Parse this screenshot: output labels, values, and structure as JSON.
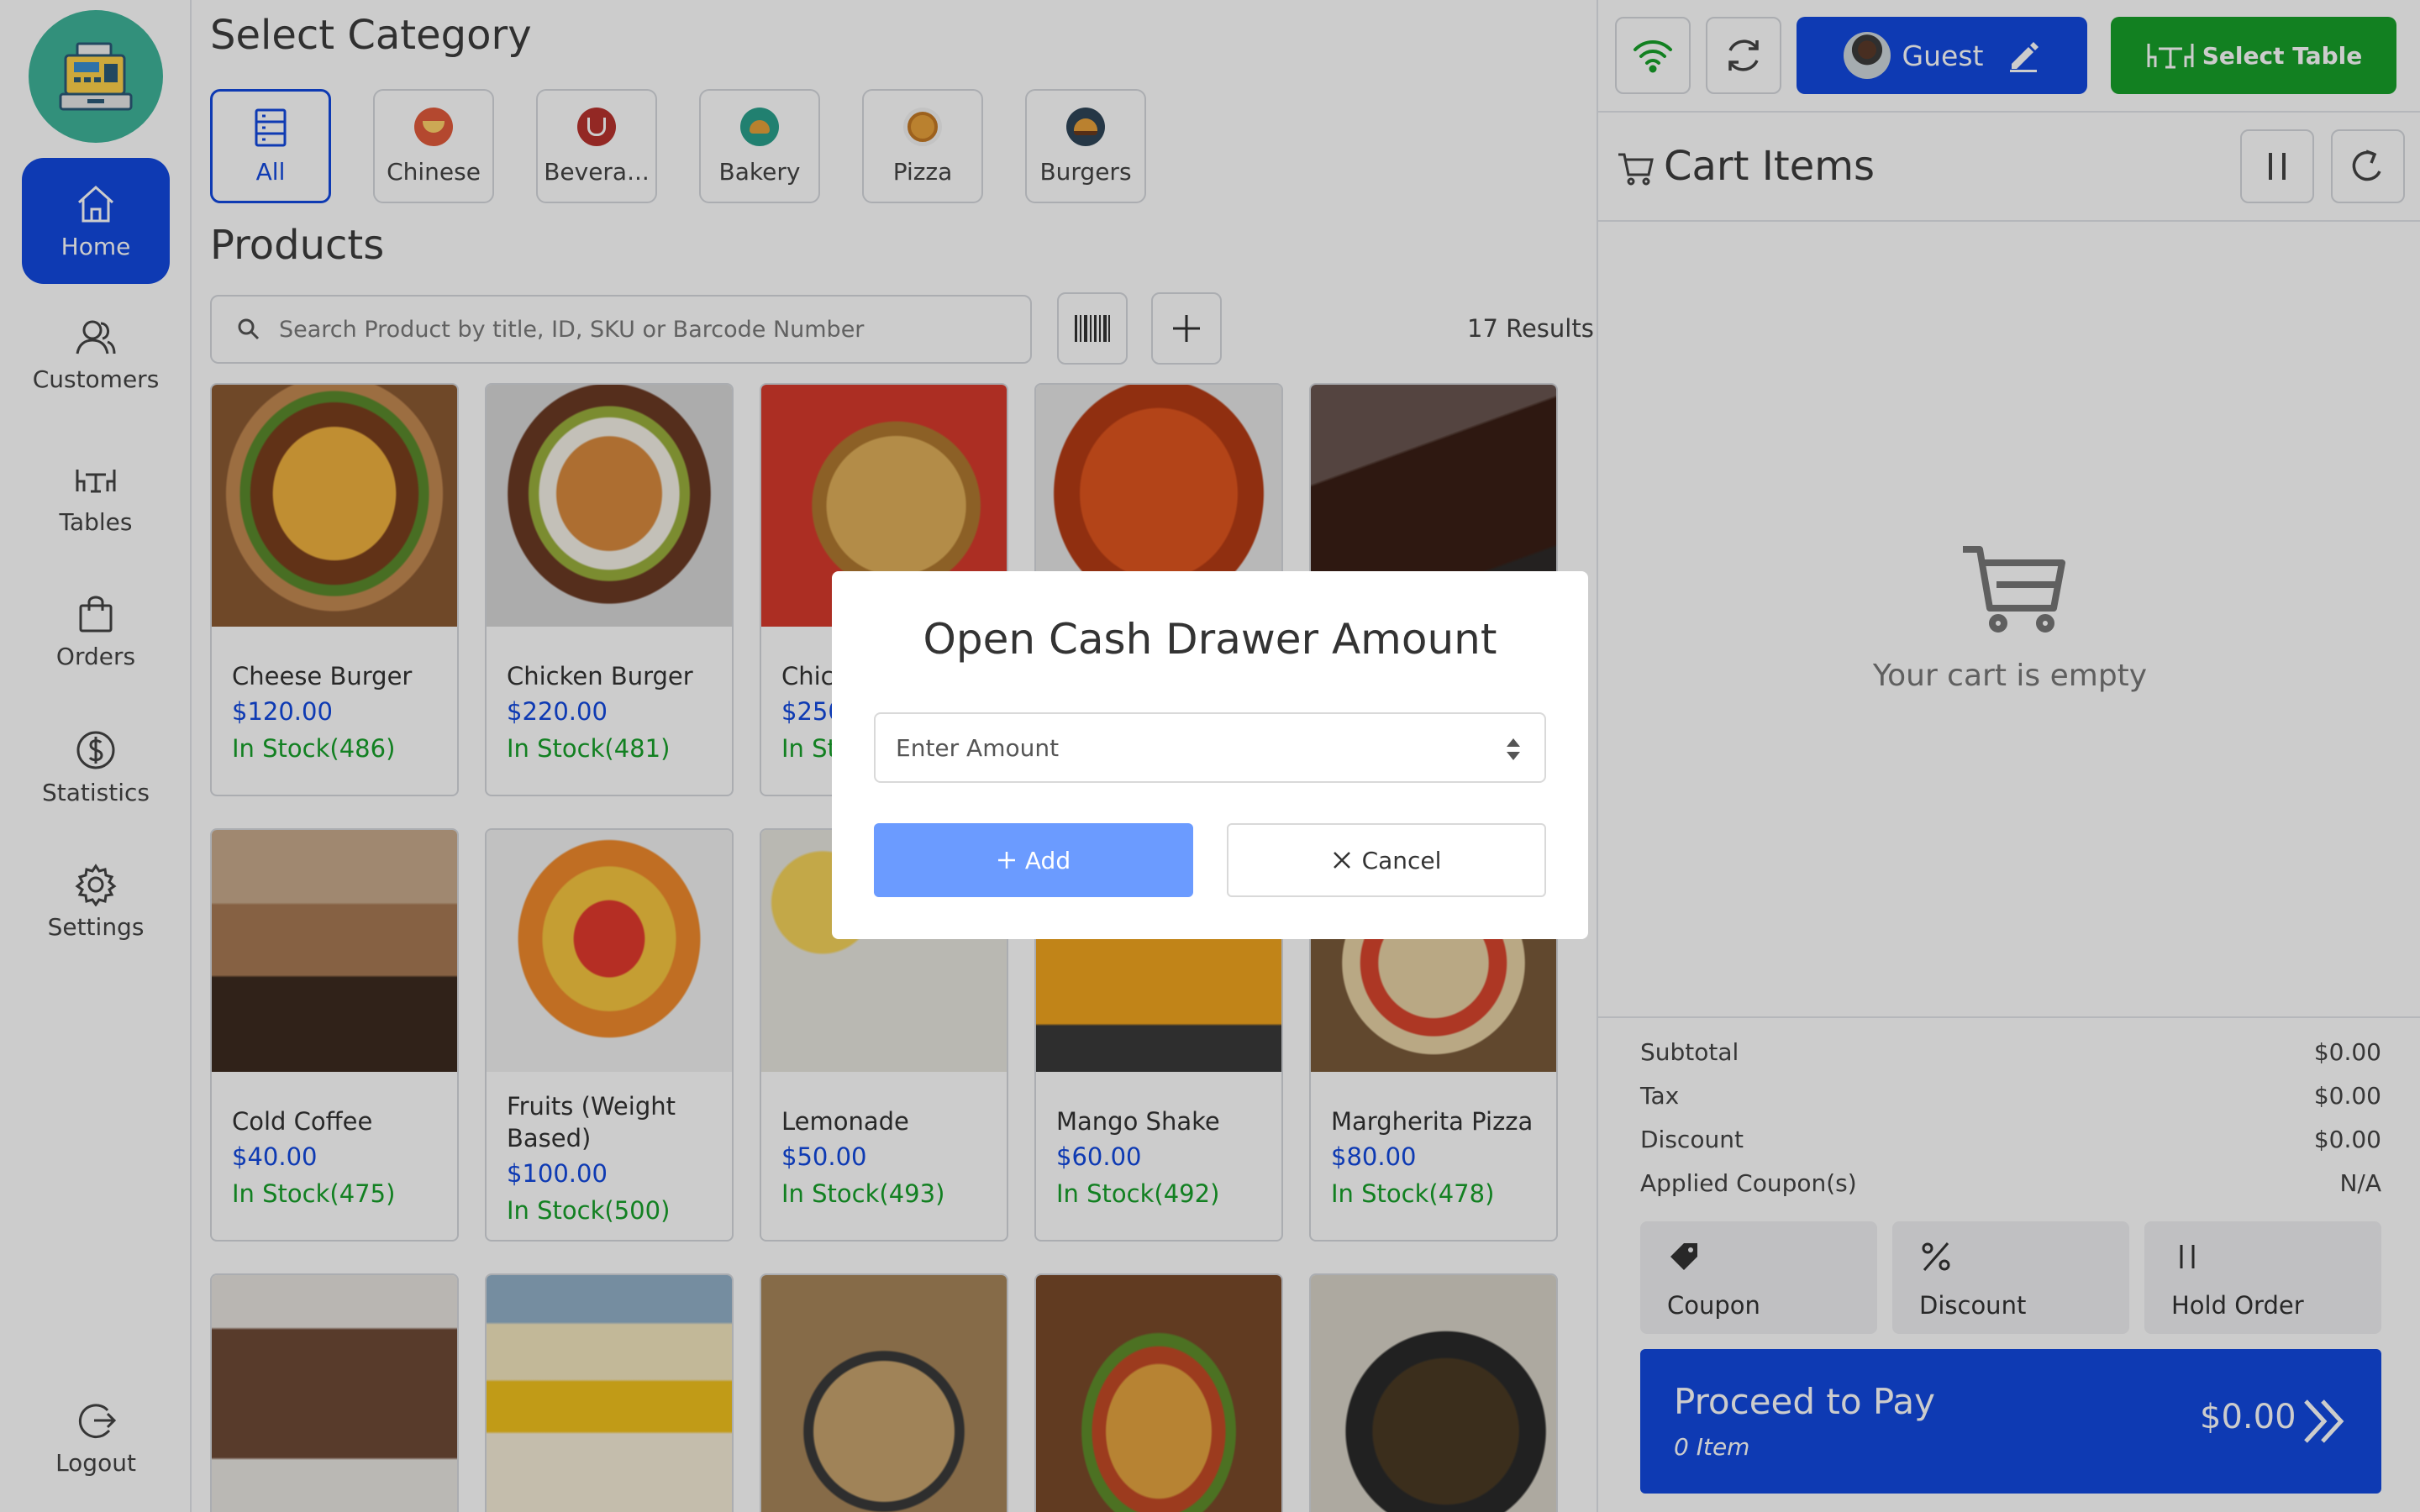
{
  "sidebar": {
    "items": [
      {
        "label": "Home",
        "icon": "home-icon"
      },
      {
        "label": "Customers",
        "icon": "customers-icon"
      },
      {
        "label": "Tables",
        "icon": "tables-icon"
      },
      {
        "label": "Orders",
        "icon": "orders-icon"
      },
      {
        "label": "Statistics",
        "icon": "statistics-icon"
      },
      {
        "label": "Settings",
        "icon": "settings-icon"
      }
    ],
    "logout": "Logout"
  },
  "categories": {
    "title": "Select Category",
    "items": [
      "All",
      "Chinese",
      "Bevera...",
      "Bakery",
      "Pizza",
      "Burgers"
    ]
  },
  "products": {
    "title": "Products",
    "search_placeholder": "Search Product by title, ID, SKU or Barcode Number",
    "results": "17 Results",
    "items": [
      {
        "title": "Cheese Burger",
        "price": "$120.00",
        "stock": "In Stock(486)"
      },
      {
        "title": "Chicken Burger",
        "price": "$220.00",
        "stock": "In Stock(481)"
      },
      {
        "title": "Chic",
        "price": "$250",
        "stock": "In St"
      },
      {
        "title": "",
        "price": "",
        "stock": ""
      },
      {
        "title": "",
        "price": "",
        "stock": ""
      },
      {
        "title": "Cold Coffee",
        "price": "$40.00",
        "stock": "In Stock(475)"
      },
      {
        "title": "Fruits (Weight Based)",
        "price": "$100.00",
        "stock": "In Stock(500)"
      },
      {
        "title": "Lemonade",
        "price": "$50.00",
        "stock": "In Stock(493)"
      },
      {
        "title": "Mango Shake",
        "price": "$60.00",
        "stock": "In Stock(492)"
      },
      {
        "title": "Margherita Pizza",
        "price": "$80.00",
        "stock": "In Stock(478)"
      }
    ]
  },
  "header": {
    "guest": "Guest",
    "select_table": "Select Table"
  },
  "cart": {
    "title": "Cart Items",
    "empty": "Your cart is empty",
    "subtotal_label": "Subtotal",
    "subtotal": "$0.00",
    "tax_label": "Tax",
    "tax": "$0.00",
    "discount_label": "Discount",
    "discount": "$0.00",
    "coupons_label": "Applied Coupon(s)",
    "coupons": "N/A",
    "coupon_btn": "Coupon",
    "discount_btn": "Discount",
    "hold_btn": "Hold Order",
    "pay_label": "Proceed to Pay",
    "pay_items": "0 Item",
    "pay_total": "$0.00"
  },
  "modal": {
    "title": "Open Cash Drawer Amount",
    "placeholder": "Enter Amount",
    "add": "Add",
    "cancel": "Cancel"
  },
  "colors": {
    "primary": "#1249e0",
    "success": "#17a02a",
    "logo": "#3fb59a",
    "add_button": "#6b9bff"
  }
}
